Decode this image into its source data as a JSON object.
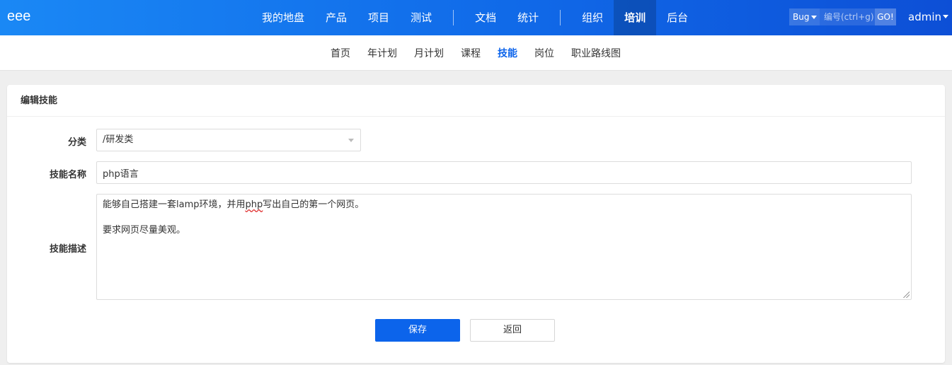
{
  "header": {
    "logo": "eee",
    "nav": [
      {
        "label": "我的地盘",
        "active": false
      },
      {
        "label": "产品",
        "active": false
      },
      {
        "label": "项目",
        "active": false
      },
      {
        "label": "测试",
        "active": false
      },
      {
        "label": "文档",
        "active": false
      },
      {
        "label": "统计",
        "active": false
      },
      {
        "label": "组织",
        "active": false
      },
      {
        "label": "培训",
        "active": true
      },
      {
        "label": "后台",
        "active": false
      }
    ],
    "search": {
      "type": "Bug",
      "placeholder": "编号(ctrl+g)",
      "go_label": "GO!"
    },
    "user": "admin"
  },
  "subnav": [
    {
      "label": "首页",
      "active": false
    },
    {
      "label": "年计划",
      "active": false
    },
    {
      "label": "月计划",
      "active": false
    },
    {
      "label": "课程",
      "active": false
    },
    {
      "label": "技能",
      "active": true
    },
    {
      "label": "岗位",
      "active": false
    },
    {
      "label": "职业路线图",
      "active": false
    }
  ],
  "panel": {
    "title": "编辑技能",
    "fields": {
      "category": {
        "label": "分类",
        "value": "/研发类"
      },
      "name": {
        "label": "技能名称",
        "value": "php语言"
      },
      "description": {
        "label": "技能描述",
        "line1_before": "能够自己搭建一套lamp环境，并用",
        "line1_misspelled": "php",
        "line1_after": "写出自己的第一个网页。",
        "line2": "要求网页尽量美观。"
      }
    },
    "save_label": "保存",
    "back_label": "返回"
  },
  "colors": {
    "primary": "#0c64eb",
    "header_gradient_start": "#1a88f5",
    "header_gradient_end": "#0d4fd6"
  }
}
